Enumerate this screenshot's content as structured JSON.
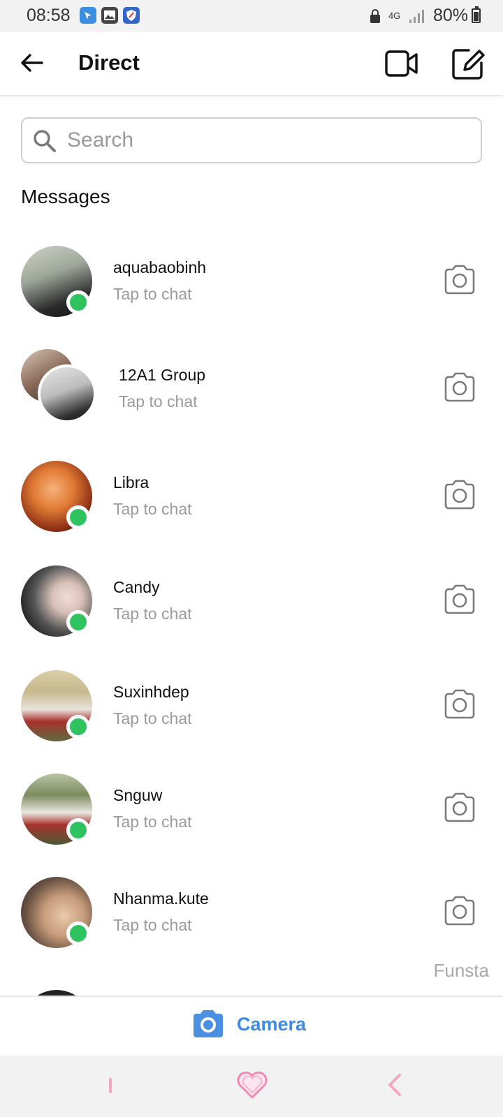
{
  "status_bar": {
    "time": "08:58",
    "network": "4G",
    "battery": "80%",
    "icons": [
      "location-app-icon",
      "gallery-icon",
      "shield-app-icon",
      "lock-icon",
      "signal-icon",
      "battery-icon"
    ]
  },
  "header": {
    "title": "Direct",
    "back_icon": "arrow-left-icon",
    "video_icon": "video-camera-icon",
    "compose_icon": "new-message-icon"
  },
  "search": {
    "placeholder": "Search",
    "value": ""
  },
  "section_title": "Messages",
  "conversations": [
    {
      "name": "aquabaobinh",
      "subtitle": "Tap to chat",
      "online": true
    },
    {
      "name": "12A1 Group",
      "subtitle": "Tap to chat",
      "online": false
    },
    {
      "name": "Libra",
      "subtitle": "Tap to chat",
      "online": true
    },
    {
      "name": "Candy",
      "subtitle": "Tap to chat",
      "online": true
    },
    {
      "name": "Suxinhdep",
      "subtitle": "Tap to chat",
      "online": true
    },
    {
      "name": "Snguw",
      "subtitle": "Tap to chat",
      "online": true
    },
    {
      "name": "Nhanma.kute",
      "subtitle": "Tap to chat",
      "online": true
    }
  ],
  "watermark": "Funsta",
  "camera_bar": {
    "label": "Camera"
  },
  "colors": {
    "accent": "#3d8ae0",
    "online": "#2ec35e",
    "nav_pink": "#f2a7c0"
  }
}
